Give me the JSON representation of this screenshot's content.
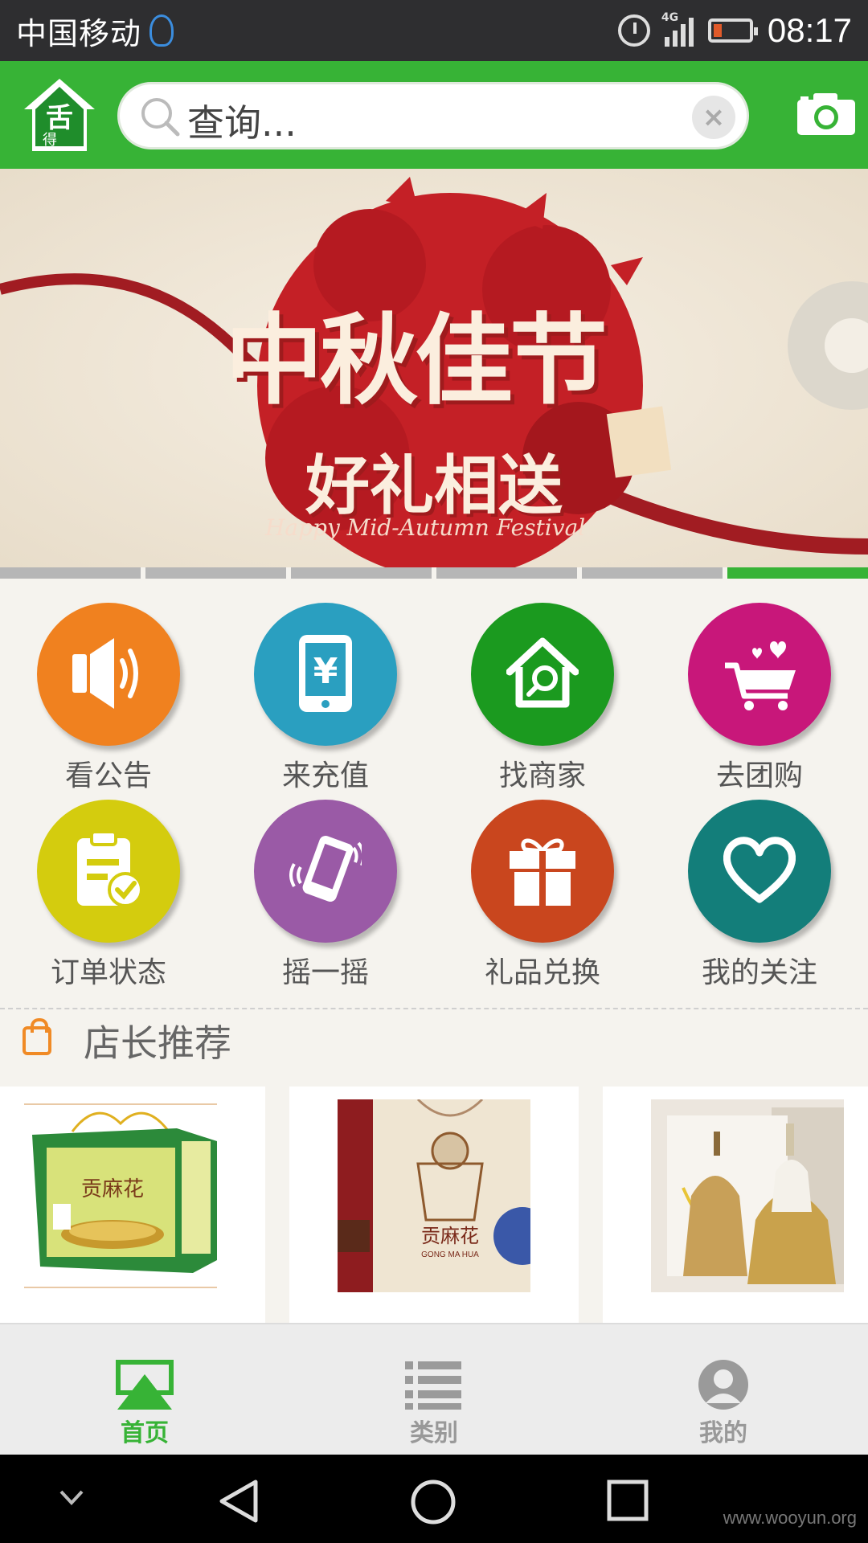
{
  "status_bar": {
    "carrier": "中国移动",
    "network": "4G",
    "time": "08:17"
  },
  "header": {
    "logo_text": "舌得",
    "search_placeholder": "查询...",
    "clear_label": "×"
  },
  "banner": {
    "title": "中秋佳节",
    "subtitle": "好礼相送",
    "english": "Happy Mid-Autumn Festival",
    "slide_count": 6,
    "active_slide": 6
  },
  "grid": {
    "items": [
      {
        "label": "看公告",
        "icon": "speaker-icon",
        "color": "#f0811f"
      },
      {
        "label": "来充值",
        "icon": "phone-yuan-icon",
        "color": "#2a9fc0"
      },
      {
        "label": "找商家",
        "icon": "house-search-icon",
        "color": "#1b9a1f"
      },
      {
        "label": "去团购",
        "icon": "cart-icon",
        "color": "#c8177a"
      },
      {
        "label": "订单状态",
        "icon": "clipboard-check-icon",
        "color": "#d4cc0e"
      },
      {
        "label": "摇一摇",
        "icon": "shake-phone-icon",
        "color": "#9a5aa6"
      },
      {
        "label": "礼品兑换",
        "icon": "gift-icon",
        "color": "#c9461e"
      },
      {
        "label": "我的关注",
        "icon": "heart-icon",
        "color": "#137e7a"
      }
    ]
  },
  "section": {
    "title": "店长推荐"
  },
  "products": [
    {
      "name": "贡麻花",
      "image": "product-box-green"
    },
    {
      "name": "贡麻花",
      "sub": "GONG MA HUA",
      "image": "product-box-red"
    },
    {
      "name": "",
      "image": "product-gold-dispenser"
    }
  ],
  "tabs": [
    {
      "label": "首页",
      "icon": "home-icon",
      "active": true
    },
    {
      "label": "类别",
      "icon": "list-icon",
      "active": false
    },
    {
      "label": "我的",
      "icon": "user-icon",
      "active": false
    }
  ],
  "watermark": "www.wooyun.org",
  "colors": {
    "brand_green": "#37b336",
    "status_bar": "#2e2e30"
  }
}
